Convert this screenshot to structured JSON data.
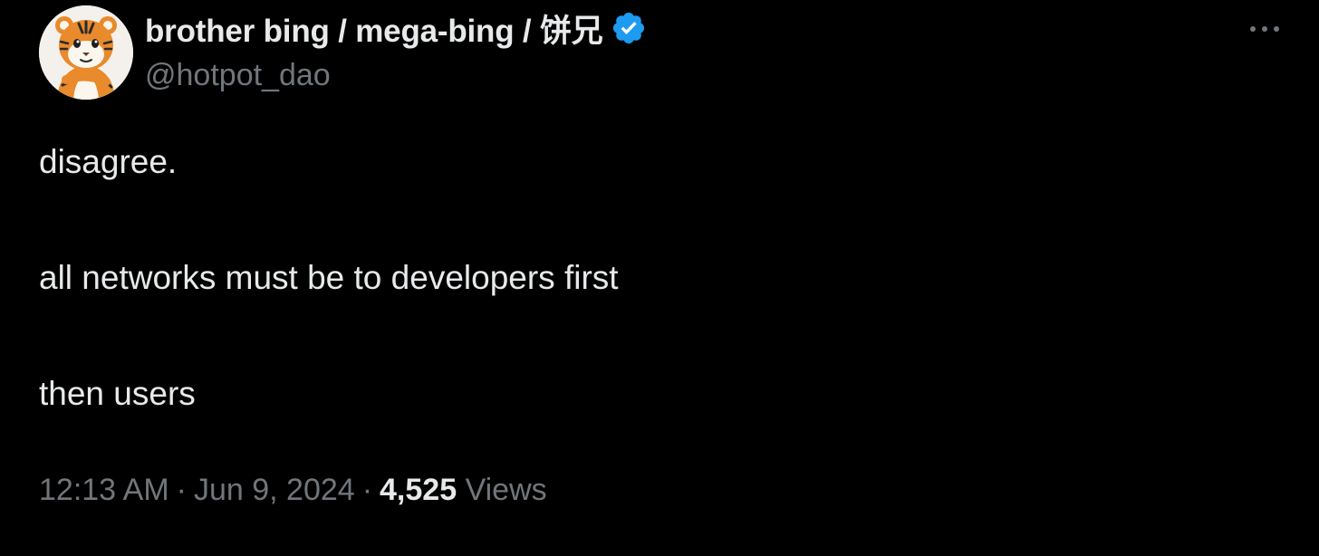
{
  "tweet": {
    "author": {
      "display_name": "brother bing / mega-bing / 饼兄",
      "handle": "@hotpot_dao",
      "verified": true,
      "avatar_icon": "tiger-avatar"
    },
    "text_lines": [
      "disagree.",
      "all networks must be to developers first",
      "then users"
    ],
    "time": "12:13 AM",
    "date": "Jun 9, 2024",
    "separator": "·",
    "views_count": "4,525",
    "views_label": "Views"
  },
  "colors": {
    "background": "#000000",
    "primary_text": "#e7e9ea",
    "secondary_text": "#71767b",
    "verified_badge": "#1d9bf0"
  },
  "icons": {
    "verified": "verified-badge-icon",
    "more": "more-options-icon"
  }
}
